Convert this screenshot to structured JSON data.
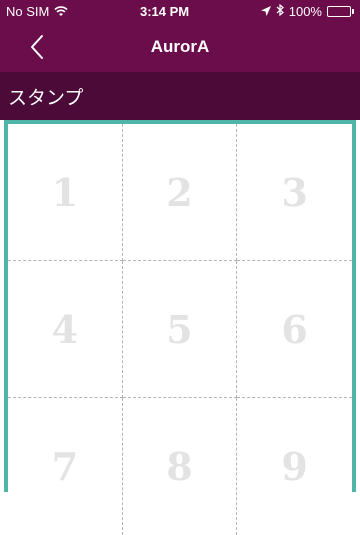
{
  "status_bar": {
    "carrier": "No SIM",
    "time": "3:14 PM",
    "battery": "100%"
  },
  "nav": {
    "title": "AurorA",
    "back_icon": "chevron-left-icon"
  },
  "section": {
    "title": "スタンプ"
  },
  "stamps": [
    "1",
    "2",
    "3",
    "4",
    "5",
    "6",
    "7",
    "8",
    "9"
  ],
  "colors": {
    "nav_bg": "#6b0d4b",
    "section_bg": "#4b0a37",
    "grid_border": "#4fb6a5",
    "stamp_number": "#e3e3e3",
    "battery_fill": "#4cd964"
  }
}
